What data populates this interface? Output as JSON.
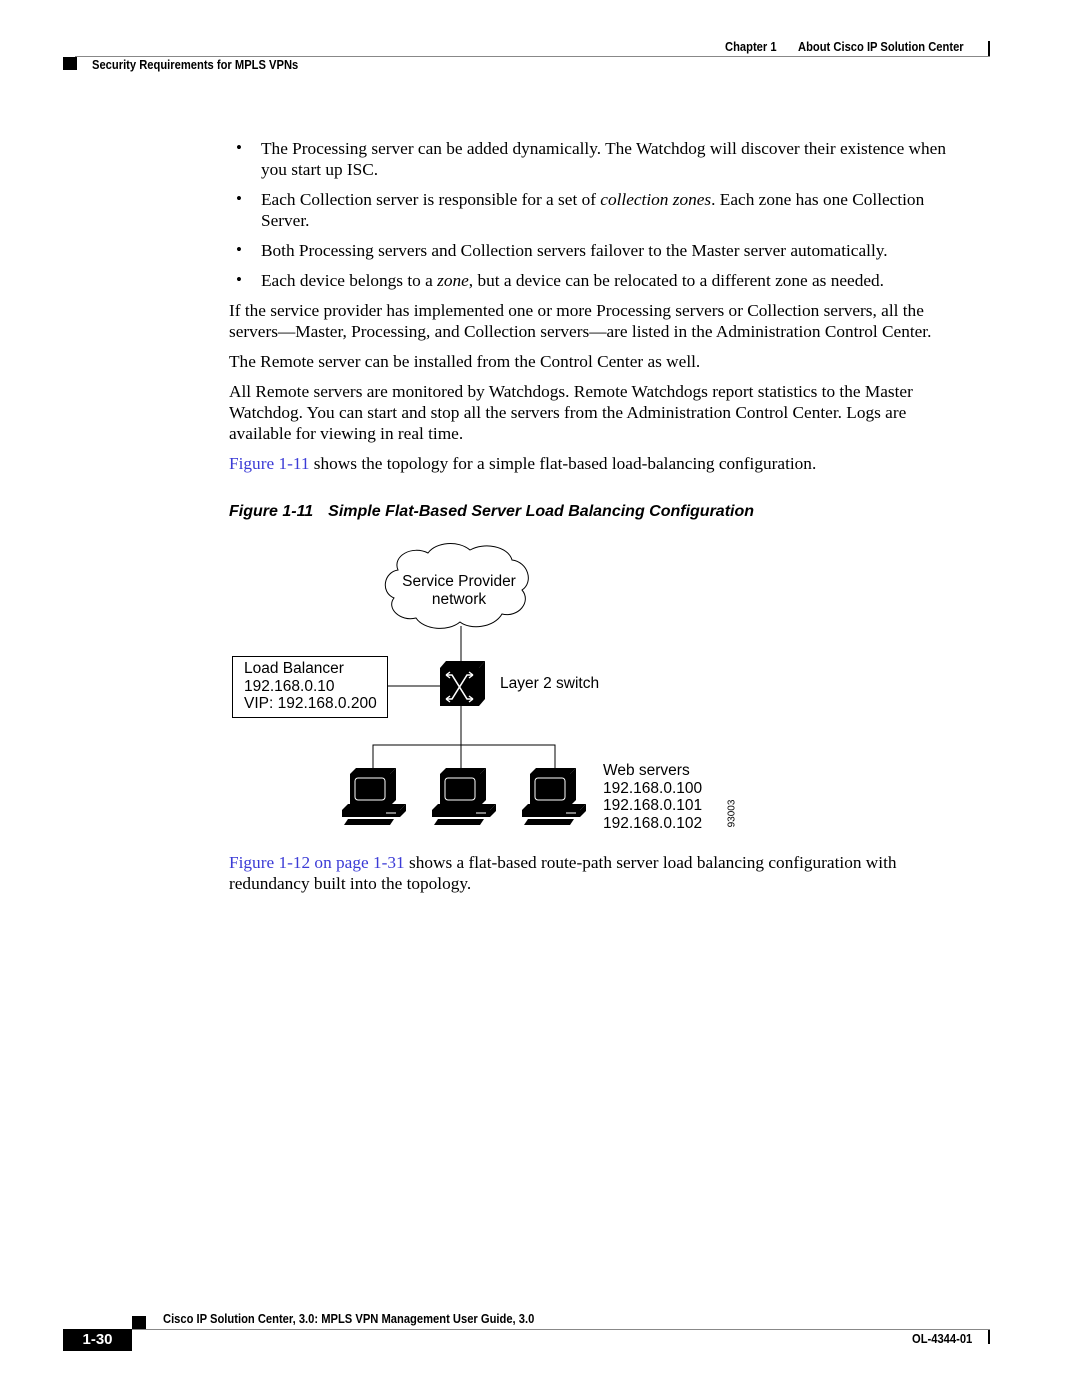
{
  "header": {
    "chapter": "Chapter 1",
    "chapter_title": "About Cisco IP Solution Center",
    "section": "Security Requirements for MPLS VPNs"
  },
  "bullets": [
    {
      "lines": [
        "The Processing server can be added dynamically. The Watchdog will discover their existence when",
        "you start up ISC."
      ]
    },
    {
      "l1a": "Each Collection server is responsible for a set of ",
      "l1i": "collection zones",
      "l1b": ". Each zone has one Collection",
      "l2": "Server."
    },
    {
      "lines": [
        "Both Processing servers and Collection servers failover to the Master server automatically."
      ]
    },
    {
      "a": "Each device belongs to a ",
      "i": "zone",
      "b": ", but a device can be relocated to a different zone as needed."
    }
  ],
  "paragraphs": [
    {
      "lines": [
        "If the service provider has implemented one or more Processing servers or Collection servers, all the",
        "servers—Master, Processing, and Collection servers—are listed in the Administration Control Center."
      ]
    },
    {
      "lines": [
        "The Remote server can be installed from the Control Center as well."
      ]
    },
    {
      "lines": [
        "All Remote servers are monitored by Watchdogs. Remote Watchdogs report statistics to the Master",
        "Watchdog. You can start and stop all the servers from the Administration Control Center. Logs are",
        "available for viewing in real time."
      ]
    },
    {
      "link": "Figure 1-11",
      "text": " shows the topology for a simple flat-based load-balancing configuration."
    }
  ],
  "figure": {
    "number": "Figure 1-11",
    "title": "Simple Flat-Based Server Load Balancing Configuration",
    "cloud_lines": [
      "Service Provider",
      "network"
    ],
    "load_balancer_lines": [
      "Load Balancer",
      "192.168.0.10",
      "VIP: 192.168.0.200"
    ],
    "switch_label": "Layer 2 switch",
    "web_servers_lines": [
      "Web servers",
      "192.168.0.100",
      "192.168.0.101",
      "192.168.0.102"
    ],
    "figure_id": "93003"
  },
  "closing": {
    "link": "Figure 1-12 on page 1-31",
    "line1": " shows a flat-based route-path server load balancing configuration with",
    "line2": "redundancy built into the topology."
  },
  "footer": {
    "book_title": "Cisco IP Solution Center, 3.0: MPLS VPN Management User Guide, 3.0",
    "page_number": "1-30",
    "doc_number": "OL-4344-01"
  },
  "colors": {
    "link": "#3b3bd6"
  }
}
